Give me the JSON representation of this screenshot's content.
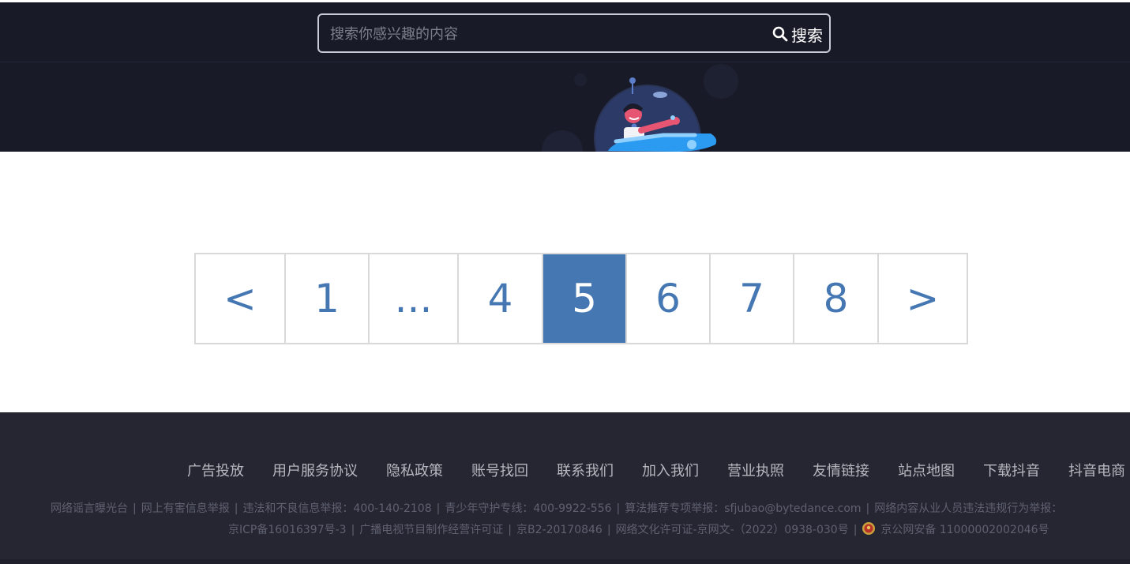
{
  "header": {
    "search": {
      "placeholder": "搜索你感兴趣的内容",
      "button_label": "搜索",
      "button_icon": "search-icon"
    }
  },
  "banner": {
    "illustration": "astronaut-on-spaceship-illustration"
  },
  "pagination": {
    "prev_label": "<",
    "next_label": ">",
    "items": [
      "1",
      "...",
      "4",
      "5",
      "6",
      "7",
      "8"
    ],
    "current_page": "5",
    "accent_color": "#4577b2"
  },
  "footer": {
    "links": [
      "广告投放",
      "用户服务协议",
      "隐私政策",
      "账号找回",
      "联系我们",
      "加入我们",
      "营业执照",
      "友情链接",
      "站点地图",
      "下载抖音",
      "抖音电商"
    ],
    "info_line1": [
      "网络谣言曝光台",
      "网上有害信息举报",
      "违法和不良信息举报：400-140-2108",
      "青少年守护专线：400-9922-556",
      "算法推荐专项举报：sfjubao@bytedance.com",
      "网络内容从业人员违法违规行为举报："
    ],
    "info_line2": [
      "京ICP备16016397号-3",
      "广播电视节目制作经营许可证",
      "京B2-20170846",
      "网络文化许可证-京网文-（2022）0938-030号",
      "京公网安备 11000002002046号"
    ],
    "police_icon": "police-emblem-icon"
  },
  "colors": {
    "header_bg": "#181a27",
    "footer_bg": "#252632",
    "page_active_bg": "#4577b2",
    "page_text": "#4577b2"
  }
}
